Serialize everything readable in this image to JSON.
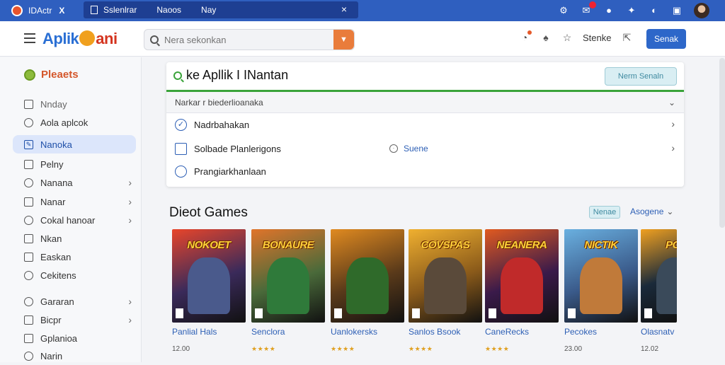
{
  "browser": {
    "tabs": [
      {
        "label": "IDActr",
        "close": "X"
      },
      {
        "label": "Sslenlrar",
        "extra1": "Naoos",
        "extra2": "Nay",
        "close": "×"
      }
    ]
  },
  "header": {
    "logo": {
      "part1": "Aplik",
      "part2": "ani"
    },
    "search": {
      "placeholder": "Nera sekonkan"
    },
    "right_label": "Stenke",
    "button_label": "Senak"
  },
  "sidebar": {
    "heading": "Pleaets",
    "items": [
      {
        "label": "Nnday",
        "icon": "tray-icon",
        "chevron": false
      },
      {
        "label": "Aola aplcok",
        "icon": "gear-icon",
        "chevron": false
      },
      {
        "label": "Nanoka",
        "icon": "pen-icon",
        "chevron": false,
        "active": true
      },
      {
        "label": "Pelny",
        "icon": "square-icon",
        "chevron": false
      },
      {
        "label": "Nanana",
        "icon": "bell-icon",
        "chevron": true
      },
      {
        "label": "Nanar",
        "icon": "home-icon",
        "chevron": true
      },
      {
        "label": "Cokal hanoar",
        "icon": "search-icon",
        "chevron": true
      },
      {
        "label": "Nkan",
        "icon": "box-icon",
        "chevron": false
      },
      {
        "label": "Easkan",
        "icon": "lock-icon",
        "chevron": false
      },
      {
        "label": "Cekitens",
        "icon": "user-icon",
        "chevron": false
      },
      {
        "label": "Gararan",
        "icon": "gear-icon",
        "chevron": true
      },
      {
        "label": "Bicpr",
        "icon": "square-icon",
        "chevron": true
      },
      {
        "label": "Gplanioa",
        "icon": "lock-icon",
        "chevron": false
      },
      {
        "label": "Narin",
        "icon": "gear-icon",
        "chevron": false
      }
    ]
  },
  "panel": {
    "title": "ke Apllik I INantan",
    "button_label": "Nerm Senaln",
    "subheader": "Narkar r biederlioanaka",
    "rows": [
      {
        "label": "Nadrbahakan",
        "icon": "check-circle-icon"
      },
      {
        "label": "Solbade Planlerigons",
        "icon": "checkbox-icon",
        "mid_label": "Suene"
      },
      {
        "label": "Prangiarkhanlaan",
        "icon": "circle-icon"
      }
    ]
  },
  "games": {
    "title": "Dieot Games",
    "chip_label": "Nenae",
    "sort_label": "Asogene",
    "items": [
      {
        "cover_title": "NOKOET",
        "name": "Panlial Hals",
        "meta": "12.00",
        "bg": "#3a2a5a",
        "fig": "#4a5a8c",
        "accent": "#e8452a"
      },
      {
        "cover_title": "BONAURE",
        "name": "Senclora",
        "meta": "★★★★",
        "bg": "#4a6a3a",
        "fig": "#2f7a3a",
        "accent": "#e0742a"
      },
      {
        "cover_title": "",
        "name": "Uanlokersks",
        "meta": "★★★★",
        "bg": "#5a3a1a",
        "fig": "#2f6a2a",
        "accent": "#e08a20"
      },
      {
        "cover_title": "COVSPAS",
        "name": "Sanlos Bsook",
        "meta": "★★★★",
        "bg": "#8a5a1a",
        "fig": "#5a4a3a",
        "accent": "#f0b030"
      },
      {
        "cover_title": "NEANERA",
        "name": "CaneRecks",
        "meta": "★★★★",
        "bg": "#3a1a4a",
        "fig": "#c02a2a",
        "accent": "#e05a20"
      },
      {
        "cover_title": "NICTIK",
        "name": "Pecokes",
        "meta": "23.00",
        "bg": "#3a5a8a",
        "fig": "#c07a3a",
        "accent": "#6ab0e0"
      },
      {
        "cover_title": "POIS",
        "name": "Olasnatv",
        "meta": "12.02",
        "bg": "#1a2a3a",
        "fig": "#3a4a5a",
        "accent": "#f0a020"
      }
    ]
  },
  "colors": {
    "brand": "#2f5fbf",
    "accent": "#e97c3b",
    "active": "#dce6fb",
    "green": "#3aa33a"
  }
}
